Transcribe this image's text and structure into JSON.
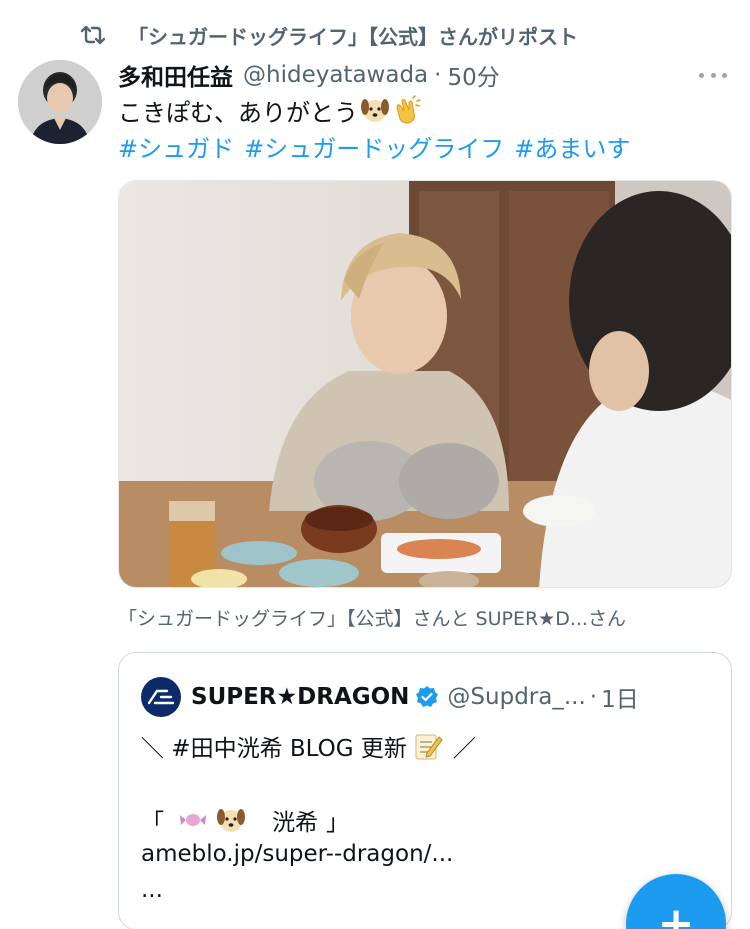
{
  "repost": {
    "label": "「シュガードッグライフ」【公式】さんがリポスト",
    "icon": "repost-icon"
  },
  "tweet": {
    "display_name": "多和田任益",
    "handle": "@hideyatawada",
    "separator": "·",
    "time": "50分",
    "more_icon": "more-icon",
    "text": "こきぽむ、ありがとう",
    "emojis": [
      "dog-emoji",
      "clap-emoji"
    ],
    "hashtags": [
      "#シュガド",
      "#シュガードッグライフ",
      "#あまいす"
    ],
    "tagged_users": "「シュガードッグライフ」【公式】さんと SUPER★D...さん"
  },
  "quote": {
    "display_name": "SUPER★DRAGON",
    "handle": "@Supdra_...",
    "separator": "·",
    "time": "1日",
    "verified_icon": "verified-badge-icon",
    "line1": "＼ #田中洸希 BLOG 更新",
    "line1_end": "／",
    "line2_open": "「",
    "line2_name": "洸希",
    "line2_close": "」",
    "line3": "ameblo.jp/super--dragon/...",
    "line4": "..."
  },
  "compose": {
    "label": "+",
    "icon": "compose-plus-icon"
  },
  "colors": {
    "accent": "#1d9bf0",
    "text_primary": "#0f1419",
    "text_secondary": "#536471",
    "border": "#cfd9de"
  }
}
